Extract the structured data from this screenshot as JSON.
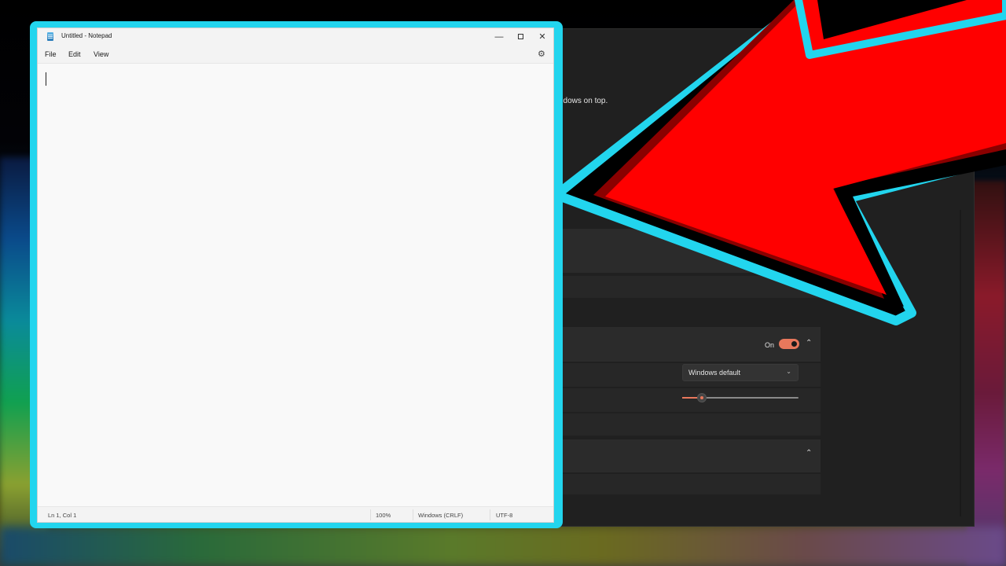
{
  "notepad": {
    "title": "Untitled - Notepad",
    "menu": [
      "File",
      "Edit",
      "View"
    ],
    "status": {
      "position": "Ln 1, Col 1",
      "zoom": "100%",
      "line_ending": "Windows (CRLF)",
      "encoding": "UTF-8"
    },
    "icons": {
      "app": "notepad-icon",
      "minimize": "minimize-icon",
      "maximize": "maximize-icon",
      "close": "close-icon",
      "settings": "gear-icon"
    }
  },
  "settings_window": {
    "description_fragment": "ndows on top.",
    "toggle_label": "On",
    "toggle_state": true,
    "dropdown_value": "Windows default",
    "slider_value_fraction": 0.15,
    "accent_color": "#e8785c"
  },
  "overlay": {
    "arrow_color": "#ff0000",
    "outline_color": "#22d5ee"
  }
}
